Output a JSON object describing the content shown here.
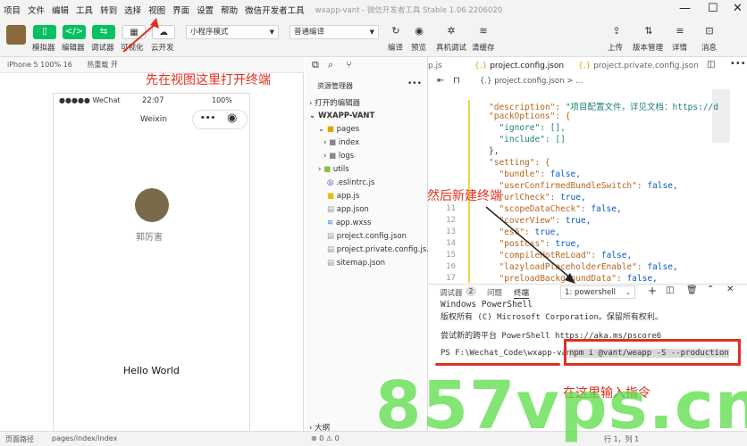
{
  "menubar": {
    "items": [
      "项目",
      "文件",
      "编辑",
      "工具",
      "转到",
      "选择",
      "视图",
      "界面",
      "设置",
      "帮助",
      "微信开发者工具"
    ],
    "app_title": "wxapp-vant - 微信开发者工具 Stable 1.06.2206020"
  },
  "toolbar": {
    "simulator": "模拟器",
    "editor": "编辑器",
    "debugger": "调试器",
    "visual": "可视化",
    "cloud": "云开发",
    "mode_select": "小程序模式",
    "compile_select": "普通编译",
    "compile": "编译",
    "preview": "预览",
    "real_debug": "真机调试",
    "clear_cache": "清缓存",
    "upload": "上传",
    "version": "版本管理",
    "details": "详情",
    "messages": "消息"
  },
  "simulator": {
    "device": "iPhone 5 100% 16",
    "hotreload": "热重载 开",
    "carrier": "●●●●● WeChat",
    "time": "22:07",
    "battery": "100%",
    "nav_title": "Weixin",
    "nav_more": "•••",
    "username": "郭厉害",
    "hello": "Hello World"
  },
  "filetree": {
    "header": "资源管理器",
    "open_editors": "打开的编辑器",
    "project": "WXAPP-VANT",
    "items": [
      "pages",
      "index",
      "logs",
      "utils",
      ".eslintrc.js",
      "app.js",
      "app.json",
      "app.wxss",
      "project.config.json",
      "project.private.config.js...",
      "sitemap.json"
    ],
    "outline": "大纲"
  },
  "editor": {
    "tabs": [
      "p.js",
      "project.config.json",
      "project.private.config.json"
    ],
    "breadcrumb": "{.} project.config.json > ...",
    "line_numbers": [
      "11",
      "12",
      "13",
      "14",
      "15",
      "16",
      "17"
    ],
    "lines": [
      [
        "\"description\": ",
        "\"项目配置文件，详见文档：https://d"
      ],
      [
        "\"packOptions\": {",
        ""
      ],
      [
        "  \"ignore\": [],",
        ""
      ],
      [
        "  \"include\": []",
        ""
      ],
      [
        "},",
        ""
      ],
      [
        "\"setting\": {",
        ""
      ],
      [
        "  \"bundle\": ",
        "false,"
      ],
      [
        "  \"userConfirmedBundleSwitch\": ",
        "false,"
      ],
      [
        "  \"urlCheck\": ",
        "true,"
      ],
      [
        "  \"scopeDataCheck\": ",
        "false,"
      ],
      [
        "  \"coverView\": ",
        "true,"
      ],
      [
        "  \"es6\": ",
        "true,"
      ],
      [
        "  \"postcss\": ",
        "true,"
      ],
      [
        "  \"compileHotReLoad\": ",
        "false,"
      ],
      [
        "  \"lazyloadPlaceholderEnable\": ",
        "false,"
      ],
      [
        "  \"preloadBackgroundData\": ",
        "false,"
      ]
    ]
  },
  "terminal": {
    "tabs": [
      "调试器",
      "问题",
      "终端"
    ],
    "badge": "2",
    "shell_select": "1: powershell",
    "lines": [
      "Windows PowerShell",
      "版权所有 (C) Microsoft Corporation。保留所有权利。",
      "尝试新的跨平台 PowerShell https://aka.ms/pscore6"
    ],
    "prompt": "PS F:\\Wechat_Code\\wxapp-vant>",
    "command": "npm i @vant/weapp -S --production"
  },
  "annotations": [
    "先在视图这里打开终端",
    "然后新建终端",
    "在这里输入指令"
  ],
  "statusbar": {
    "path_label": "页面路径",
    "path": "pages/index/index",
    "errors": "⊗ 0 ⚠ 0",
    "cursor": "行 1，列 1"
  },
  "watermark": "857vps.cn",
  "colors": {
    "accent": "#07c160",
    "annotation": "#e0301e"
  }
}
